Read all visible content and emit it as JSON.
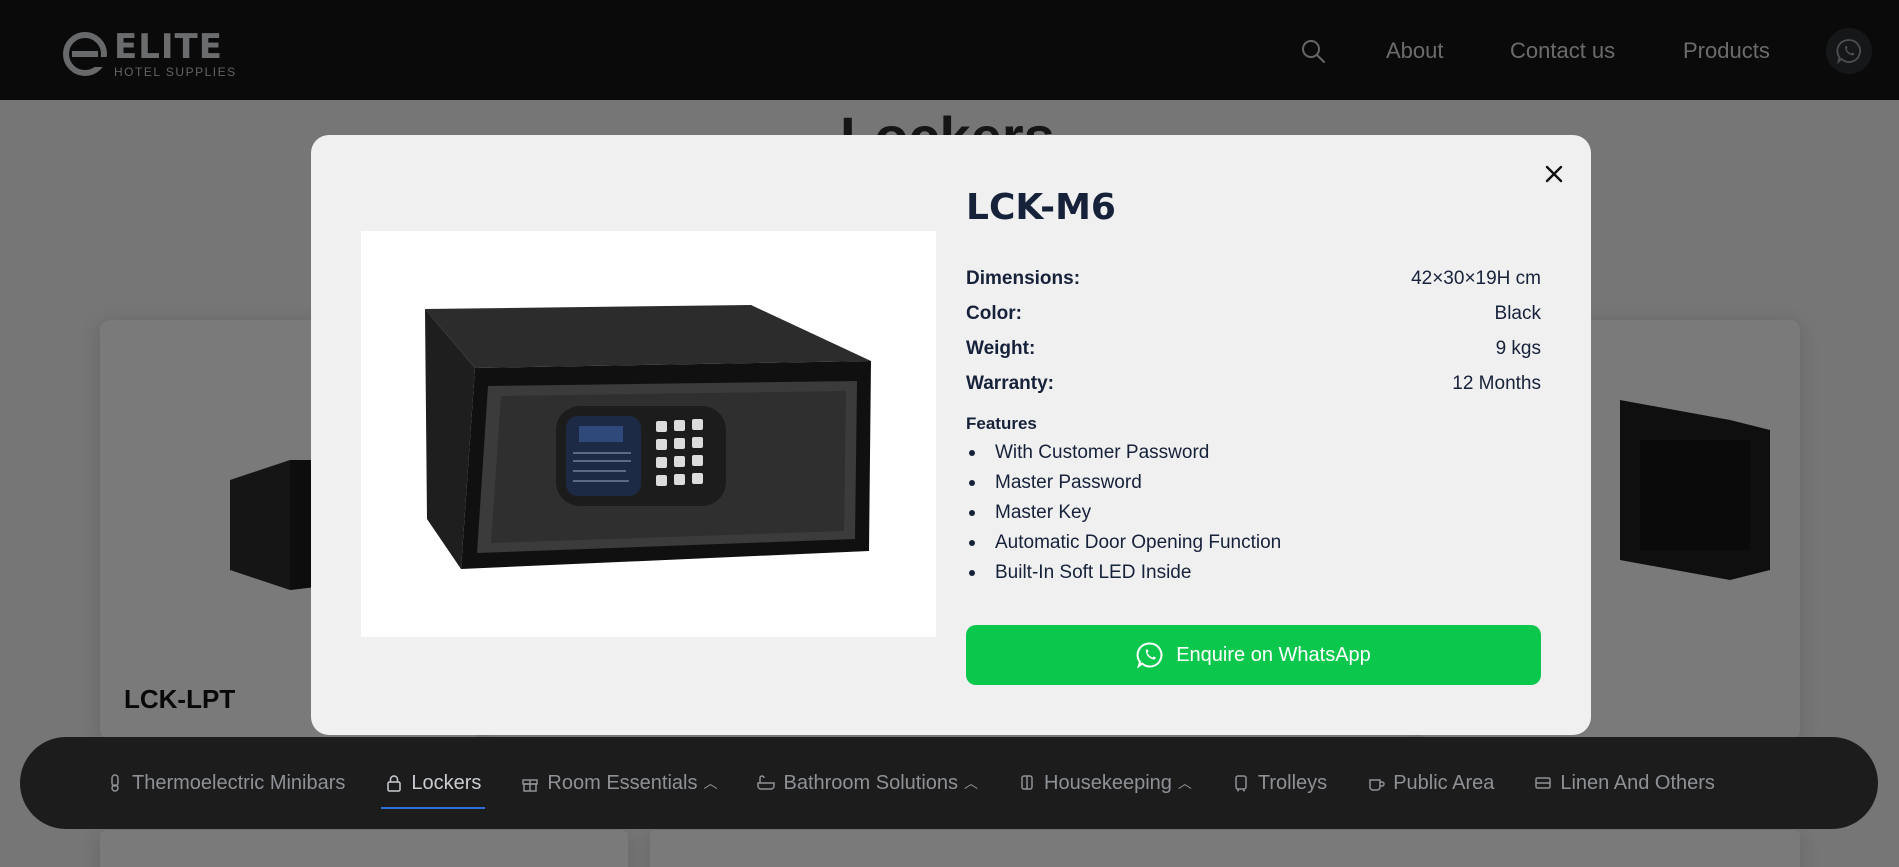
{
  "brand": {
    "logo_word": "ELITE",
    "logo_sub": "HOTEL SUPPLIES"
  },
  "nav": {
    "about": "About",
    "contact": "Contact us",
    "products": "Products",
    "search_icon": "search-icon",
    "whatsapp_icon": "whatsapp-icon"
  },
  "background": {
    "heading": "Lockers",
    "card_left_title": "LCK-LPT"
  },
  "categories": [
    {
      "label": "Thermoelectric Minibars",
      "icon": "thermo-icon",
      "dropdown": false,
      "active": false
    },
    {
      "label": "Lockers",
      "icon": "lock-icon",
      "dropdown": false,
      "active": true
    },
    {
      "label": "Room Essentials",
      "icon": "gift-icon",
      "dropdown": true,
      "active": false
    },
    {
      "label": "Bathroom Solutions",
      "icon": "bathtub-icon",
      "dropdown": true,
      "active": false
    },
    {
      "label": "Housekeeping",
      "icon": "cart-icon",
      "dropdown": true,
      "active": false
    },
    {
      "label": "Trolleys",
      "icon": "trolley-icon",
      "dropdown": false,
      "active": false
    },
    {
      "label": "Public Area",
      "icon": "cup-icon",
      "dropdown": false,
      "active": false
    },
    {
      "label": "Linen And Others",
      "icon": "bed-icon",
      "dropdown": false,
      "active": false
    }
  ],
  "modal": {
    "title": "LCK-M6",
    "specs": [
      {
        "label": "Dimensions:",
        "value": "42×30×19H cm"
      },
      {
        "label": "Color:",
        "value": "Black"
      },
      {
        "label": "Weight:",
        "value": "9 kgs"
      },
      {
        "label": "Warranty:",
        "value": "12 Months"
      }
    ],
    "features_title": "Features",
    "features": [
      "With Customer Password",
      "Master Password",
      "Master Key",
      "Automatic Door Opening Function",
      "Built-In Soft LED Inside"
    ],
    "cta": "Enquire on WhatsApp",
    "close_icon": "close-icon"
  },
  "colors": {
    "whatsapp_green": "#0bc84d",
    "nav_bg": "#151515",
    "active_underline": "#2f6fd6",
    "modal_bg": "#f0f0f0",
    "title_navy": "#16213a"
  }
}
